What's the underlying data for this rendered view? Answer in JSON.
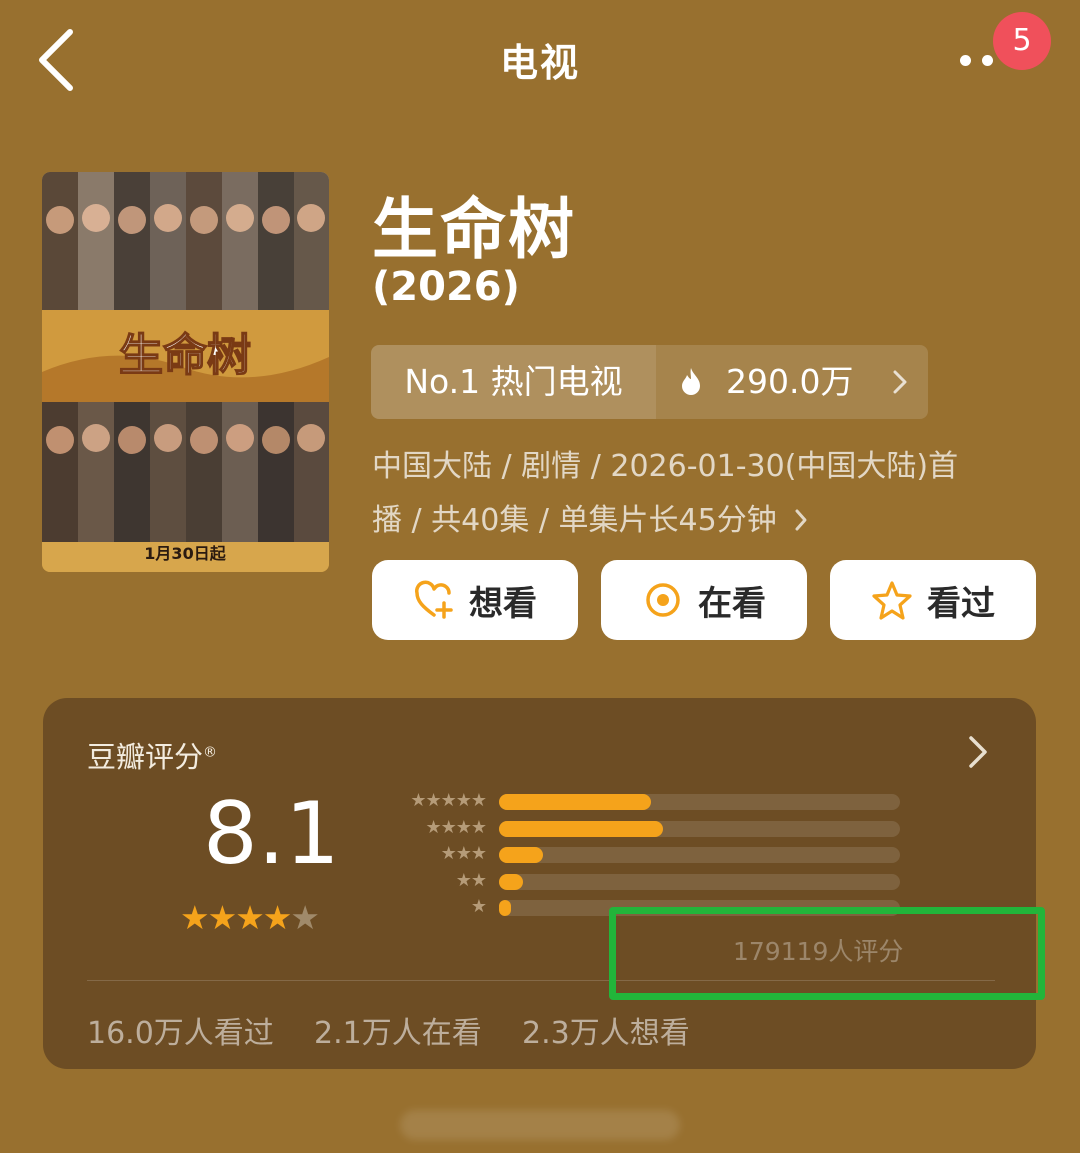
{
  "header": {
    "title": "电视",
    "badge_count": "5"
  },
  "show": {
    "title": "生命树",
    "year": "(2026)"
  },
  "ranking": {
    "rank_label": "No.1 热门电视",
    "heat": "290.0万"
  },
  "meta": {
    "line1": "中国大陆 / 剧情 / 2026-01-30(中国大陆)首",
    "line2": "播 / 共40集 / 单集片长45分钟"
  },
  "actions": [
    {
      "label": "想看",
      "icon": "heart-plus-icon"
    },
    {
      "label": "在看",
      "icon": "target-circle-icon"
    },
    {
      "label": "看过",
      "icon": "star-outline-icon"
    }
  ],
  "rating": {
    "title": "豆瓣评分",
    "registered_mark": "®",
    "score": "8.1",
    "stars_shown": 4,
    "distribution": [
      {
        "stars": 5,
        "fraction": 0.38
      },
      {
        "stars": 4,
        "fraction": 0.41
      },
      {
        "stars": 3,
        "fraction": 0.11
      },
      {
        "stars": 2,
        "fraction": 0.06
      },
      {
        "stars": 1,
        "fraction": 0.03
      }
    ],
    "count_text": "179119人评分"
  },
  "stats": {
    "watched": "16.0万人看过",
    "watching": "2.1万人在看",
    "wish": "2.3万人想看"
  },
  "poster": {
    "title_art": "生命树",
    "date_text": "1月30日起"
  },
  "colors": {
    "background": "#98702f",
    "card": "#6d4d24",
    "bar": "#f5a31b",
    "star": "#f5a31b",
    "highlight": "#22b53a",
    "badge": "#f0505b"
  }
}
